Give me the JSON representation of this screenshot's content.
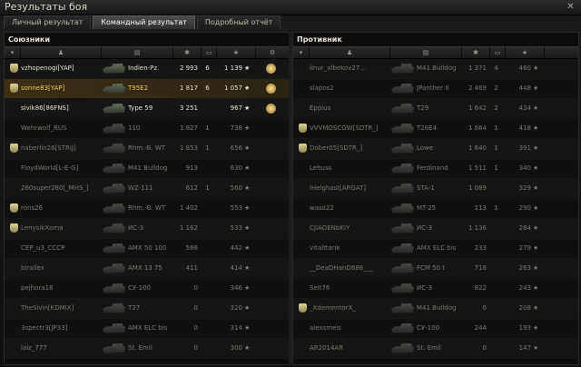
{
  "window": {
    "title": "Результаты боя"
  },
  "tabs": [
    {
      "label": "Личный результат",
      "active": false
    },
    {
      "label": "Командный результат",
      "active": true
    },
    {
      "label": "Подробный отчёт",
      "active": false
    }
  ],
  "allies": {
    "title": "Союзники",
    "rows": [
      {
        "platoon": true,
        "player": "vzhopenogi[YAP]",
        "vehicle": "Indien-Pz.",
        "damage": "2 993",
        "kills": "6",
        "xp": "1 139",
        "medal": true,
        "highlight": false,
        "dead": false
      },
      {
        "platoon": true,
        "player": "sonne83[YAP]",
        "vehicle": "T95E2",
        "damage": "1 817",
        "kills": "6",
        "xp": "1 057",
        "medal": true,
        "highlight": true,
        "dead": false
      },
      {
        "platoon": false,
        "player": "sivik86[86FNS]",
        "vehicle": "Type 59",
        "damage": "3 251",
        "kills": "",
        "xp": "967",
        "medal": true,
        "highlight": false,
        "dead": false
      },
      {
        "platoon": false,
        "player": "Wehrwolf_RUS",
        "vehicle": "110",
        "damage": "1 827",
        "kills": "1",
        "xp": "738",
        "medal": false,
        "highlight": false,
        "dead": true
      },
      {
        "platoon": true,
        "player": "naberlin26[STRIJ]",
        "vehicle": "Rhm.-B. WT",
        "damage": "1 853",
        "kills": "1",
        "xp": "656",
        "medal": false,
        "highlight": false,
        "dead": true
      },
      {
        "platoon": false,
        "player": "FloydWorld[L-E-G]",
        "vehicle": "M41 Bulldog",
        "damage": "913",
        "kills": "",
        "xp": "630",
        "medal": false,
        "highlight": false,
        "dead": true
      },
      {
        "platoon": false,
        "player": "280super280[_MHS_]",
        "vehicle": "WZ-111",
        "damage": "612",
        "kills": "1",
        "xp": "560",
        "medal": false,
        "highlight": false,
        "dead": true
      },
      {
        "platoon": true,
        "player": "rons26",
        "vehicle": "Rhm.-B. WT",
        "damage": "1 402",
        "kills": "",
        "xp": "553",
        "medal": false,
        "highlight": false,
        "dead": true
      },
      {
        "platoon": true,
        "player": "LenysikXoma",
        "vehicle": "ИС-3",
        "damage": "1 162",
        "kills": "",
        "xp": "533",
        "medal": false,
        "highlight": false,
        "dead": true
      },
      {
        "platoon": false,
        "player": "CEP_u3_CCCP",
        "vehicle": "AMX 50 100",
        "damage": "566",
        "kills": "",
        "xp": "442",
        "medal": false,
        "highlight": false,
        "dead": true
      },
      {
        "platoon": false,
        "player": "birallex",
        "vehicle": "AMX 13 75",
        "damage": "411",
        "kills": "",
        "xp": "414",
        "medal": false,
        "highlight": false,
        "dead": true
      },
      {
        "platoon": false,
        "player": "pejhora18",
        "vehicle": "СУ-100",
        "damage": "0",
        "kills": "",
        "xp": "346",
        "medal": false,
        "highlight": false,
        "dead": true
      },
      {
        "platoon": false,
        "player": "TheSivin[KDMIX]",
        "vehicle": "T37",
        "damage": "0",
        "kills": "",
        "xp": "320",
        "medal": false,
        "highlight": false,
        "dead": true
      },
      {
        "platoon": false,
        "player": "3spectr3[JP33]",
        "vehicle": "AMX ELC bis",
        "damage": "0",
        "kills": "",
        "xp": "314",
        "medal": false,
        "highlight": false,
        "dead": true
      },
      {
        "platoon": false,
        "player": "laiz_777",
        "vehicle": "St. Emil",
        "damage": "0",
        "kills": "",
        "xp": "300",
        "medal": false,
        "highlight": false,
        "dead": true
      }
    ]
  },
  "enemies": {
    "title": "Противник",
    "rows": [
      {
        "platoon": false,
        "player": "ilnur_albekov27...",
        "vehicle": "M41 Bulldog",
        "damage": "1 371",
        "kills": "4",
        "xp": "460",
        "dead": true
      },
      {
        "platoon": false,
        "player": "slapos2",
        "vehicle": "JPanther II",
        "damage": "2 469",
        "kills": "2",
        "xp": "448",
        "dead": true
      },
      {
        "platoon": false,
        "player": "Eppius",
        "vehicle": "T29",
        "damage": "1 642",
        "kills": "2",
        "xp": "434",
        "dead": true
      },
      {
        "platoon": true,
        "player": "VVVMOSCOW[SDTR_]",
        "vehicle": "T26E4",
        "damage": "1 664",
        "kills": "1",
        "xp": "418",
        "dead": true
      },
      {
        "platoon": true,
        "player": "Dober05[SDTR_]",
        "vehicle": "Lowe",
        "damage": "1 640",
        "kills": "1",
        "xp": "391",
        "dead": true
      },
      {
        "platoon": false,
        "player": "Lehuss",
        "vehicle": "Ferdinand",
        "damage": "1 511",
        "kills": "1",
        "xp": "340",
        "dead": true
      },
      {
        "platoon": false,
        "player": "iHelghast[ARGAT]",
        "vehicle": "STA-1",
        "damage": "1 089",
        "kills": "",
        "xp": "329",
        "dead": true
      },
      {
        "platoon": false,
        "player": "waso22",
        "vehicle": "MT-25",
        "damage": "113",
        "kills": "1",
        "xp": "290",
        "dead": true
      },
      {
        "platoon": false,
        "player": "CJIAOENbKIY",
        "vehicle": "ИС-3",
        "damage": "1 136",
        "kills": "",
        "xp": "284",
        "dead": true
      },
      {
        "platoon": false,
        "player": "vitalttank",
        "vehicle": "AMX ELC bis",
        "damage": "233",
        "kills": "",
        "xp": "279",
        "dead": true
      },
      {
        "platoon": false,
        "player": "__DeaDHanD888___",
        "vehicle": "FCM 50 t",
        "damage": "718",
        "kills": "",
        "xp": "263",
        "dead": true
      },
      {
        "platoon": false,
        "player": "Seit76",
        "vehicle": "ИС-3",
        "damage": "822",
        "kills": "",
        "xp": "243",
        "dead": true
      },
      {
        "platoon": true,
        "player": "_XdementorX_",
        "vehicle": "M41 Bulldog",
        "damage": "0",
        "kills": "",
        "xp": "208",
        "dead": true
      },
      {
        "platoon": false,
        "player": "alexsmeis",
        "vehicle": "СУ-100",
        "damage": "244",
        "kills": "",
        "xp": "193",
        "dead": true
      },
      {
        "platoon": false,
        "player": "AR2014AR",
        "vehicle": "St. Emil",
        "damage": "0",
        "kills": "",
        "xp": "147",
        "dead": true
      }
    ]
  }
}
